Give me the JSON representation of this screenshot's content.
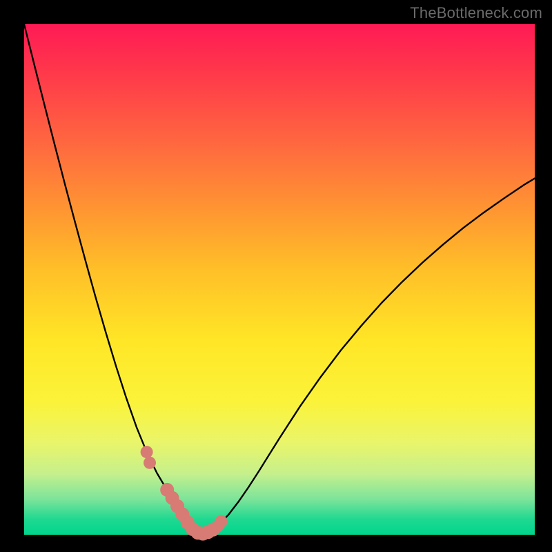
{
  "watermark": "TheBottleneck.com",
  "colors": {
    "frame": "#000000",
    "gradient_top": "#ff1a55",
    "gradient_bottom": "#00d68e",
    "marker": "#d77b74",
    "curve": "#000000"
  },
  "chart_data": {
    "type": "line",
    "title": "",
    "xlabel": "",
    "ylabel": "",
    "xlim": [
      0,
      100
    ],
    "ylim": [
      0,
      100
    ],
    "x": [
      0,
      2,
      4,
      6,
      8,
      10,
      12,
      14,
      16,
      18,
      20,
      22,
      24,
      26,
      27,
      28,
      29,
      30,
      31,
      32,
      33,
      34,
      35,
      36,
      38,
      40,
      42,
      44,
      46,
      48,
      50,
      54,
      58,
      62,
      66,
      70,
      74,
      78,
      82,
      86,
      90,
      94,
      98,
      100
    ],
    "y": [
      100,
      92,
      84.1,
      76.3,
      68.6,
      61.1,
      53.7,
      46.5,
      39.6,
      33,
      26.8,
      21.1,
      16.2,
      12.1,
      10.4,
      8.8,
      7.2,
      5.6,
      4,
      2.4,
      1.1,
      0.4,
      0.2,
      0.5,
      1.8,
      3.9,
      6.5,
      9.4,
      12.5,
      15.7,
      18.9,
      25.1,
      30.8,
      36.1,
      40.9,
      45.4,
      49.5,
      53.3,
      56.8,
      60.1,
      63.1,
      65.9,
      68.6,
      69.8
    ],
    "markers": {
      "x": [
        24.0,
        24.6,
        28.0,
        29.0,
        30.0,
        31.0,
        32.0,
        33.0,
        34.0,
        35.0,
        36.0,
        37.0,
        37.9,
        38.6
      ],
      "y": [
        16.2,
        14.1,
        8.8,
        7.2,
        5.6,
        4.0,
        2.4,
        1.1,
        0.4,
        0.2,
        0.5,
        1.0,
        1.7,
        2.6
      ],
      "r": [
        9,
        9,
        10,
        10,
        10,
        10,
        10,
        10,
        10,
        10,
        10,
        10,
        9,
        9
      ]
    }
  }
}
